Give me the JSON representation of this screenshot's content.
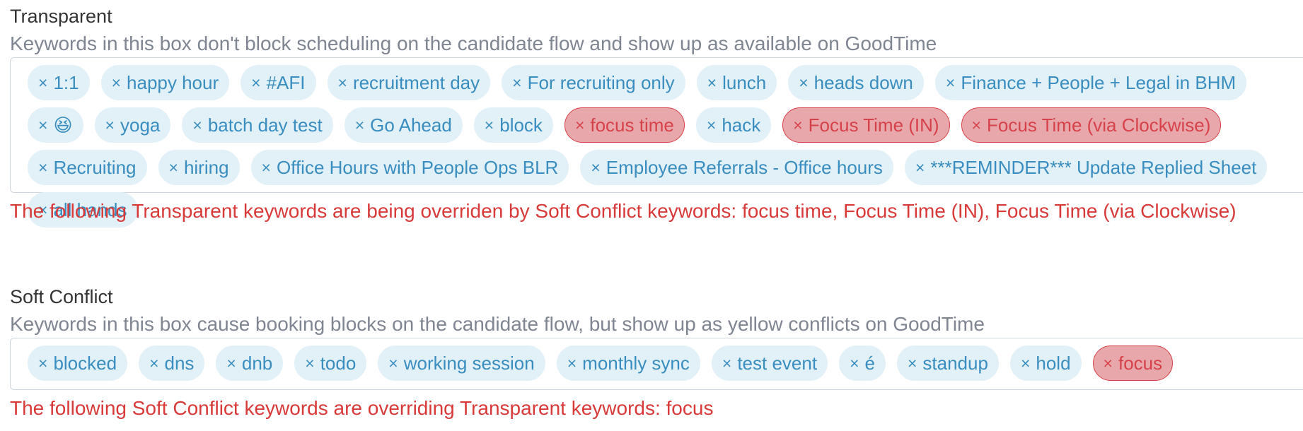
{
  "transparent": {
    "title": "Transparent",
    "description": "Keywords in this box don't block scheduling on the candidate flow and show up as available on GoodTime",
    "tags": [
      {
        "label": "1:1",
        "conflict": false
      },
      {
        "label": "happy hour",
        "conflict": false
      },
      {
        "label": "#AFI",
        "conflict": false
      },
      {
        "label": "recruitment day",
        "conflict": false
      },
      {
        "label": "For recruiting only",
        "conflict": false
      },
      {
        "label": "lunch",
        "conflict": false
      },
      {
        "label": "heads down",
        "conflict": false
      },
      {
        "label": "Finance + People + Legal in BHM",
        "conflict": false
      },
      {
        "label": "😆",
        "conflict": false
      },
      {
        "label": "yoga",
        "conflict": false
      },
      {
        "label": "batch day test",
        "conflict": false
      },
      {
        "label": "Go Ahead",
        "conflict": false
      },
      {
        "label": "block",
        "conflict": false
      },
      {
        "label": "focus time",
        "conflict": true
      },
      {
        "label": "hack",
        "conflict": false
      },
      {
        "label": "Focus Time (IN)",
        "conflict": true
      },
      {
        "label": "Focus Time (via Clockwise)",
        "conflict": true
      },
      {
        "label": "Recruiting",
        "conflict": false
      },
      {
        "label": "hiring",
        "conflict": false
      },
      {
        "label": "Office Hours with People Ops BLR",
        "conflict": false
      },
      {
        "label": "Employee Referrals - Office hours",
        "conflict": false
      },
      {
        "label": "***REMINDER*** Update Replied Sheet",
        "conflict": false
      },
      {
        "label": "all hands",
        "conflict": false
      }
    ],
    "error": "The following Transparent keywords are being overriden by Soft Conflict keywords: focus time, Focus Time (IN), Focus Time (via Clockwise)"
  },
  "soft_conflict": {
    "title": "Soft Conflict",
    "description": "Keywords in this box cause booking blocks on the candidate flow, but show up as yellow conflicts on GoodTime",
    "tags": [
      {
        "label": "blocked",
        "conflict": false
      },
      {
        "label": "dns",
        "conflict": false
      },
      {
        "label": "dnb",
        "conflict": false
      },
      {
        "label": "todo",
        "conflict": false
      },
      {
        "label": "working session",
        "conflict": false
      },
      {
        "label": "monthly sync",
        "conflict": false
      },
      {
        "label": "test event",
        "conflict": false
      },
      {
        "label": "é",
        "conflict": false
      },
      {
        "label": "standup",
        "conflict": false
      },
      {
        "label": "hold",
        "conflict": false
      },
      {
        "label": "focus",
        "conflict": true
      }
    ],
    "error": "The following Soft Conflict keywords are overriding Transparent keywords: focus"
  },
  "tag_remove_glyph": "×",
  "colors": {
    "tag_bg": "#e2f1f8",
    "tag_text": "#3a8dbf",
    "conflict_bg": "#e8a8ab",
    "conflict_text": "#d6424a",
    "error_text": "#d83a3a",
    "description_text": "#7f8591"
  }
}
